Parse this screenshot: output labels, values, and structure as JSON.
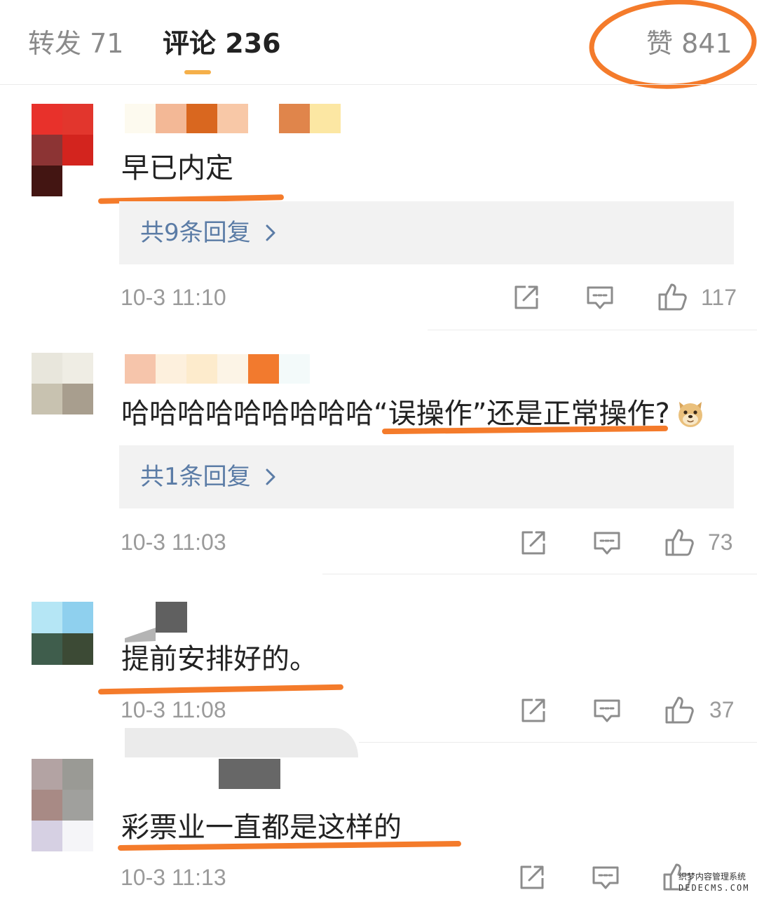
{
  "tabs": {
    "repost": {
      "label": "转发",
      "count": "71"
    },
    "comments": {
      "label": "评论",
      "count": "236"
    },
    "likes": {
      "label": "赞",
      "count": "841"
    }
  },
  "colors": {
    "annotation": "#f47b2b",
    "reply_link": "#5b7ca6",
    "active_tab_indicator": "#f5b04a",
    "meta_text": "#9a9a9a"
  },
  "icons": {
    "share": "share-icon",
    "comment": "comment-icon",
    "like": "thumbs-up-icon",
    "chevron": "chevron-right-icon",
    "emoji": "doge-emoji-icon"
  },
  "comments": [
    {
      "text": "早已内定",
      "replies_label": "共9条回复",
      "time": "10-3 11:10",
      "likes": "117",
      "avatar_colors": [
        "#e8312b",
        "#e2362d",
        "#8c3434",
        "#d3241e",
        "#431512",
        "#ffffff"
      ],
      "name_colors": [
        "#fdfaef",
        "#f3b896",
        "#d9671f",
        "#f8c8a7",
        "#ffffff",
        "#e0854b",
        "#fce7a3"
      ]
    },
    {
      "text": "哈哈哈哈哈哈哈哈哈“误操作”还是正常操作?",
      "replies_label": "共1条回复",
      "time": "10-3 11:03",
      "likes": "73",
      "avatar_colors": [
        "#e8e6dc",
        "#efede4",
        "#c8c2b0",
        "#a89e8e"
      ],
      "name_colors": [
        "#f6c5ab",
        "#fdf0dd",
        "#fdebcc",
        "#fcf4e6",
        "#f27a2e",
        "#f3fafa"
      ]
    },
    {
      "text": "提前安排好的。",
      "time": "10-3 11:08",
      "likes": "37",
      "avatar_colors": [
        "#b5e6f5",
        "#8fd0ee",
        "#3f5d4c",
        "#3c4a35"
      ],
      "name_colors": [
        "#606060"
      ]
    },
    {
      "text": "彩票业一直都是这样的",
      "time": "10-3 11:13",
      "avatar_colors": [
        "#b3a3a3",
        "#9a9a95",
        "#a88a85",
        "#a0a09d",
        "#d6d0e3",
        "#f5f5f8"
      ],
      "name_colors": [
        "#676767",
        "#676767"
      ]
    }
  ],
  "watermark": {
    "line1": "织梦内容管理系统",
    "line2": "DEDECMS.COM"
  }
}
